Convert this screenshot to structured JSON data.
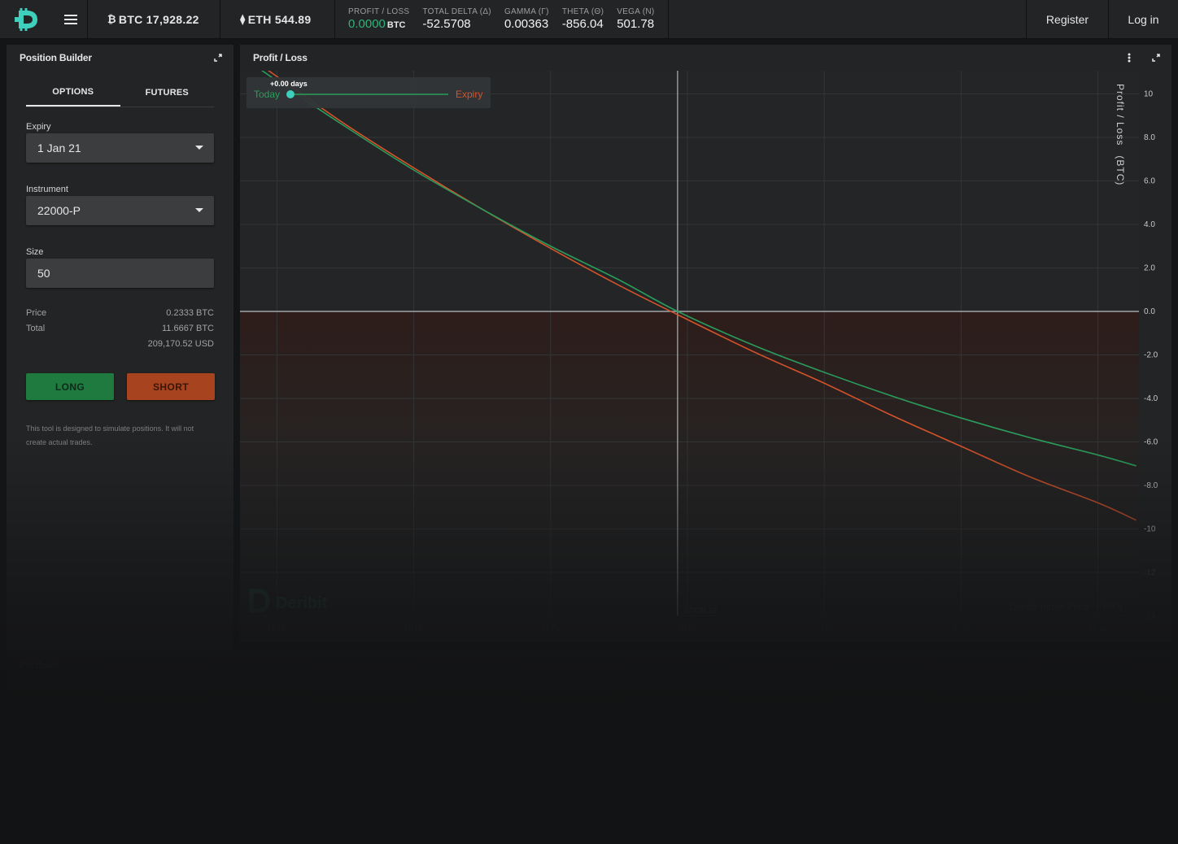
{
  "topbar": {
    "btc_label": "BTC 17,928.22",
    "eth_label": "ETH 544.89",
    "greeks": [
      {
        "label": "PROFIT / LOSS",
        "value": "0.0000",
        "unit": "BTC"
      },
      {
        "label": "TOTAL DELTA (Δ)",
        "value": "-52.5708"
      },
      {
        "label": "GAMMA (Γ)",
        "value": "0.00363"
      },
      {
        "label": "THETA (Θ)",
        "value": "-856.04"
      },
      {
        "label": "VEGA (N)",
        "value": "501.78"
      }
    ],
    "register": "Register",
    "login": "Log in"
  },
  "builder": {
    "title": "Position Builder",
    "tabs": [
      "OPTIONS",
      "FUTURES"
    ],
    "expiry_label": "Expiry",
    "expiry_value": "1 Jan 21",
    "instrument_label": "Instrument",
    "instrument_value": "22000-P",
    "size_label": "Size",
    "size_value": "50",
    "price_label": "Price",
    "price_value": "0.2333 BTC",
    "total_label": "Total",
    "total_btc": "11.6667 BTC",
    "total_usd": "209,170.52 USD",
    "long_label": "LONG",
    "short_label": "SHORT",
    "disclaimer": "This tool is designed to simulate positions. It will not create actual trades."
  },
  "pl_panel": {
    "title": "Profit / Loss"
  },
  "portfolio": {
    "title": "Portfolio"
  },
  "colors": {
    "today": "#2a9d5c",
    "expiry": "#d4532b",
    "accent_teal": "#3ecfbd",
    "zero_line": "#9a9c9e"
  },
  "chart_data": {
    "type": "line",
    "title": "",
    "slider": {
      "today_label": "Today",
      "expiry_label": "Expiry",
      "days_label": "+0.00 days"
    },
    "xlabel": "Deribit Index Price",
    "xunit": "(USD)",
    "ylabel": "Profit / Loss",
    "yunit": "(BTC)",
    "xlim": [
      14730,
      21300
    ],
    "ylim": [
      -14,
      11
    ],
    "x_ticks": [
      15000,
      16000,
      17000,
      18000,
      19000,
      20000,
      21000
    ],
    "x_tick_labels": [
      "15.0k",
      "16.0k",
      "17.0k",
      "18.0k",
      "19.0k",
      "20.0k",
      "21.0k"
    ],
    "y_ticks": [
      10,
      8,
      6,
      4,
      2,
      0,
      -2,
      -4,
      -6,
      -8,
      -10,
      -12,
      -14
    ],
    "y_tick_labels": [
      "10",
      "8.0",
      "6.0",
      "4.0",
      "2.0",
      "0.0",
      "-2.0",
      "-4.0",
      "-6.0",
      "-8.0",
      "-10",
      "-12",
      "-14"
    ],
    "crosshair_x": 17928.22,
    "crosshair_label": "17928.22",
    "watermark": "Deribit",
    "series": [
      {
        "name": "Today",
        "x": [
          14730,
          15000,
          15500,
          16000,
          16500,
          17000,
          17500,
          17928.22,
          18500,
          19000,
          19500,
          20000,
          20500,
          21000,
          21280
        ],
        "values": [
          11.8,
          10.6,
          8.5,
          6.5,
          4.7,
          3.0,
          1.45,
          0.0,
          -1.6,
          -2.8,
          -3.9,
          -4.9,
          -5.8,
          -6.6,
          -7.1
        ]
      },
      {
        "name": "Expiry",
        "x": [
          14730,
          15000,
          15500,
          16000,
          16500,
          17000,
          17500,
          17928.22,
          18500,
          19000,
          19500,
          20000,
          20500,
          21000,
          21280
        ],
        "values": [
          12.0,
          10.8,
          8.6,
          6.6,
          4.7,
          2.9,
          1.2,
          -0.15,
          -1.9,
          -3.3,
          -4.8,
          -6.2,
          -7.6,
          -8.8,
          -9.6
        ]
      }
    ]
  }
}
